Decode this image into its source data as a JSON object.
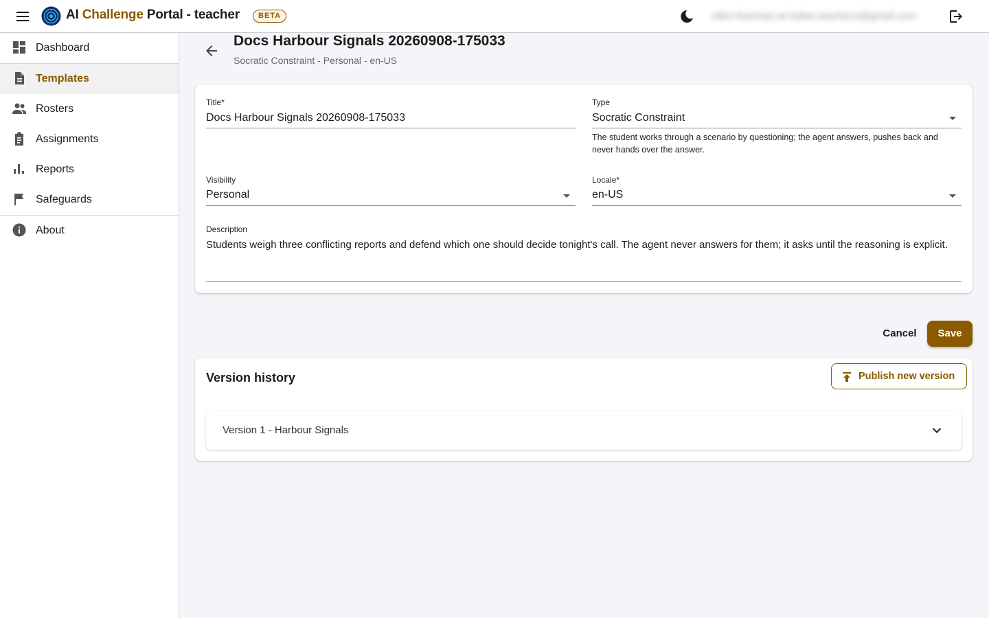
{
  "app": {
    "title_prefix": "AI ",
    "title_accent": "Challenge",
    "title_suffix": " Portal - teacher",
    "beta_badge": "BETA",
    "user_email": "ellen.freeman.wi-haber.teacher1@gmail.com"
  },
  "sidebar": {
    "items": [
      {
        "label": "Dashboard",
        "icon": "dashboard-icon"
      },
      {
        "label": "Templates",
        "icon": "document-icon",
        "active": true
      },
      {
        "label": "Rosters",
        "icon": "people-icon"
      },
      {
        "label": "Assignments",
        "icon": "clipboard-icon"
      },
      {
        "label": "Reports",
        "icon": "bar-chart-icon"
      },
      {
        "label": "Safeguards",
        "icon": "flag-icon"
      },
      {
        "label": "About",
        "icon": "info-icon"
      }
    ]
  },
  "page": {
    "title": "Docs Harbour Signals 20260908-175033",
    "subtitle": "Socratic Constraint - Personal - en-US"
  },
  "form": {
    "title_label": "Title*",
    "title_value": "Docs Harbour Signals 20260908-175033",
    "type_label": "Type",
    "type_value": "Socratic Constraint",
    "type_helper": "The student works through a scenario by questioning; the agent answers, pushes back and never hands over the answer.",
    "visibility_label": "Visibility",
    "visibility_value": "Personal",
    "locale_label": "Locale*",
    "locale_value": "en-US",
    "description_label": "Description",
    "description_value": "Students weigh three conflicting reports and defend which one should decide tonight's call. The agent never answers for them; it asks until the reasoning is explicit."
  },
  "actions": {
    "cancel_label": "Cancel",
    "save_label": "Save"
  },
  "history": {
    "title": "Version history",
    "publish_label": "Publish new version",
    "versions": [
      {
        "label": "Version 1 - Harbour Signals"
      }
    ]
  },
  "colors": {
    "accent": "#8a5a00",
    "background": "#f4f5f8",
    "logo_blue": "#0b2b6b"
  }
}
